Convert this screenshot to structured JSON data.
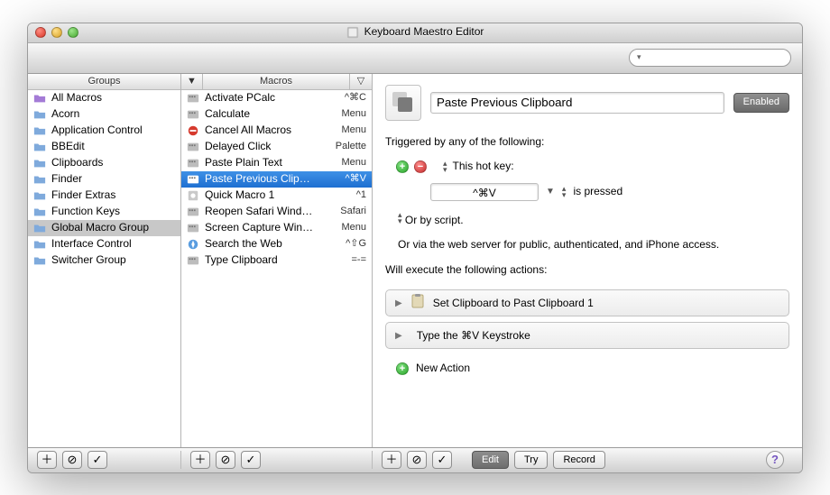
{
  "window": {
    "title": "Keyboard Maestro Editor"
  },
  "search": {
    "placeholder": ""
  },
  "columns": {
    "groups_label": "Groups",
    "macros_label": "Macros",
    "sort_arrow": "▼",
    "sort_indicator": "▽"
  },
  "groups": [
    {
      "name": "All Macros",
      "icon": "purple"
    },
    {
      "name": "Acorn",
      "icon": "folder"
    },
    {
      "name": "Application Control",
      "icon": "folder"
    },
    {
      "name": "BBEdit",
      "icon": "folder"
    },
    {
      "name": "Clipboards",
      "icon": "folder"
    },
    {
      "name": "Finder",
      "icon": "folder"
    },
    {
      "name": "Finder Extras",
      "icon": "folder"
    },
    {
      "name": "Function Keys",
      "icon": "folder"
    },
    {
      "name": "Global Macro Group",
      "icon": "folder",
      "selected": true
    },
    {
      "name": "Interface Control",
      "icon": "folder"
    },
    {
      "name": "Switcher Group",
      "icon": "folder"
    }
  ],
  "macros": [
    {
      "name": "Activate PCalc",
      "badge": "^⌘C",
      "icon": "km"
    },
    {
      "name": "Calculate",
      "badge": "Menu",
      "icon": "km"
    },
    {
      "name": "Cancel All Macros",
      "badge": "Menu",
      "icon": "cancel"
    },
    {
      "name": "Delayed Click",
      "badge": "Palette",
      "icon": "km"
    },
    {
      "name": "Paste Plain Text",
      "badge": "Menu",
      "icon": "km"
    },
    {
      "name": "Paste Previous Clipboard",
      "badge": "^⌘V",
      "icon": "km",
      "selected": true
    },
    {
      "name": "Quick Macro 1",
      "badge": "^1",
      "icon": "disk"
    },
    {
      "name": "Reopen Safari Windows",
      "badge": "Safari",
      "icon": "km"
    },
    {
      "name": "Screen Capture Window",
      "badge": "Menu",
      "icon": "km"
    },
    {
      "name": "Search the Web",
      "badge": "^⇧G",
      "icon": "safari"
    },
    {
      "name": "Type Clipboard",
      "badge": "=-=",
      "icon": "km"
    }
  ],
  "detail": {
    "name": "Paste Previous Clipboard",
    "enabled_label": "Enabled",
    "triggered_label": "Triggered by any of the following:",
    "hotkey_label": "This hot key:",
    "hotkey_value": "^⌘V",
    "hotkey_state": "is pressed",
    "or_script": "Or by script.",
    "webserver": "Or via the web server for public, authenticated, and iPhone access.",
    "actions_label": "Will execute the following actions:",
    "actions": [
      {
        "label": "Set Clipboard to Past Clipboard 1",
        "icon": "clipboard"
      },
      {
        "label": "Type the ⌘V Keystroke",
        "icon": "disk"
      }
    ],
    "new_action": "New Action"
  },
  "bottom": {
    "edit": "Edit",
    "try": "Try",
    "record": "Record",
    "help": "?"
  }
}
